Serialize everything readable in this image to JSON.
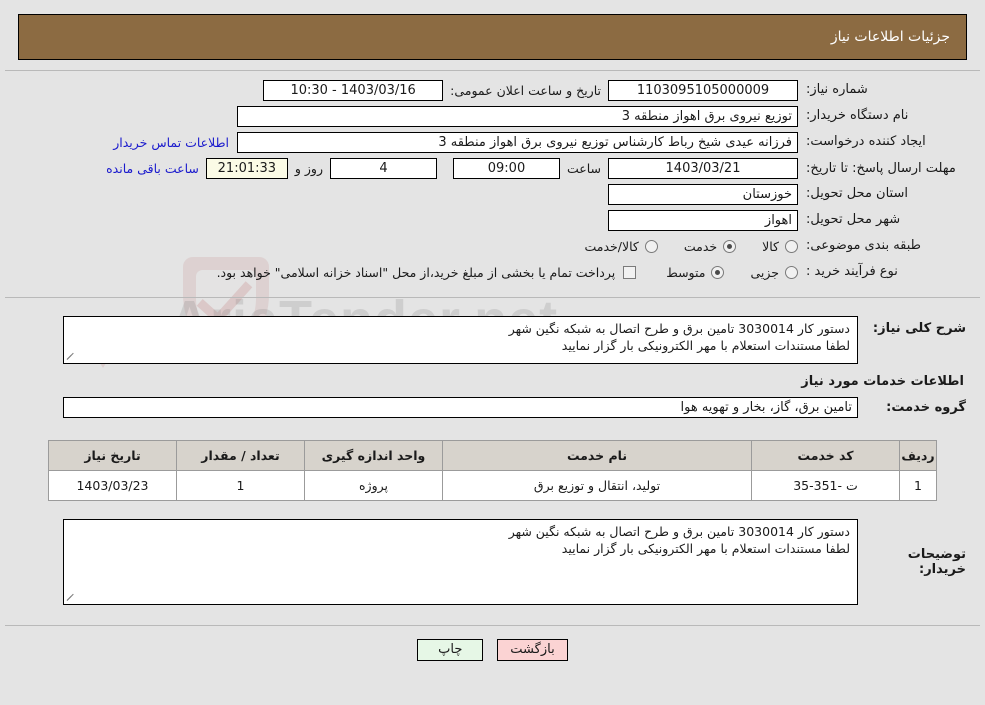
{
  "header": {
    "title": "جزئیات اطلاعات نیاز"
  },
  "summary": {
    "need_number_label": "شماره نیاز:",
    "need_number_value": "1103095105000009",
    "announce_label": "تاریخ و ساعت اعلان عمومی:",
    "announce_value": "1403/03/16 - 10:30",
    "buyer_org_label": "نام دستگاه خریدار:",
    "buyer_org_value": "توزیع نیروی برق اهواز منطقه 3",
    "requester_label": "ایجاد کننده درخواست:",
    "requester_value": "فرزانه عیدی شیخ رباط کارشناس توزیع نیروی برق اهواز منطقه 3",
    "buyer_contact_link": "اطلاعات تماس خریدار",
    "deadline_label": "مهلت ارسال پاسخ: تا تاریخ:",
    "deadline_date": "1403/03/21",
    "deadline_time_label": "ساعت",
    "deadline_time": "09:00",
    "days_remaining": "4",
    "days_text": "روز و",
    "countdown": "21:01:33",
    "countdown_suffix": "ساعت باقی مانده",
    "province_label": "استان محل تحویل:",
    "province_value": "خوزستان",
    "city_label": "شهر محل تحویل:",
    "city_value": "اهواز",
    "category_label": "طبقه بندی موضوعی:",
    "category_options": [
      {
        "label": "کالا",
        "selected": false
      },
      {
        "label": "خدمت",
        "selected": true
      },
      {
        "label": "کالا/خدمت",
        "selected": false
      }
    ],
    "process_label": "نوع فرآیند خرید :",
    "process_options": [
      {
        "label": "جزیی",
        "selected": false
      },
      {
        "label": "متوسط",
        "selected": true
      }
    ],
    "treasury_checkbox_checked": false,
    "treasury_note": "پرداخت تمام یا بخشی از مبلغ خرید،از محل \"اسناد خزانه اسلامی\" خواهد بود."
  },
  "need_description": {
    "label": "شرح کلی نیاز:",
    "lines": [
      "دستور کار 3030014 تامین برق و طرح اتصال به شبکه نگین شهر",
      "لطفا مستندات استعلام با مهر الکترونیکی بار گزار نمایید"
    ]
  },
  "services_section": {
    "title": "اطلاعات خدمات مورد نیاز",
    "group_label": "گروه خدمت:",
    "group_value": "تامین برق، گاز، بخار و تهویه هوا",
    "table": {
      "columns": [
        "ردیف",
        "کد خدمت",
        "نام خدمت",
        "واحد اندازه گیری",
        "تعداد / مقدار",
        "تاریخ نیاز"
      ],
      "rows": [
        {
          "index": "1",
          "code": "ت -351-35",
          "name": "تولید، انتقال و توزیع برق",
          "unit": "پروژه",
          "quantity": "1",
          "need_date": "1403/03/23"
        }
      ]
    }
  },
  "buyer_notes": {
    "label": "توضیحات خریدار:",
    "lines": [
      "دستور کار 3030014 تامین برق و طرح اتصال به شبکه نگین شهر",
      "لطفا مستندات استعلام با مهر الکترونیکی بار گزار نمایید"
    ]
  },
  "footer": {
    "print_label": "چاپ",
    "back_label": "بازگشت"
  },
  "watermark": {
    "text": "AriaTender.net"
  }
}
